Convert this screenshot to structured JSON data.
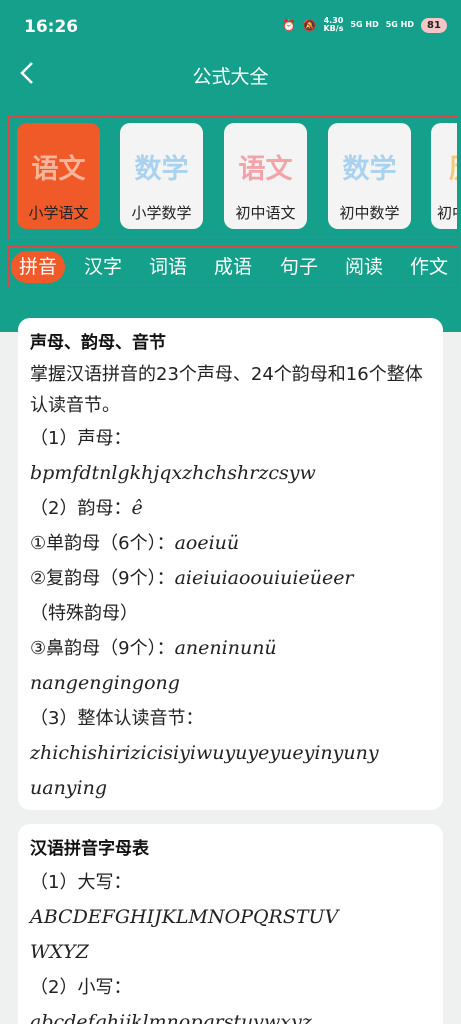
{
  "status": {
    "time": "16:26",
    "speed_top": "4.30",
    "speed_bottom": "KB/s",
    "sig1": "5G HD",
    "sig2": "5G HD",
    "battery": "81"
  },
  "header": {
    "title": "公式大全"
  },
  "categories": [
    {
      "glyph": "语文",
      "label": "小学语文",
      "color": "#f7b49b"
    },
    {
      "glyph": "数学",
      "label": "小学数学",
      "color": "#a9d2ef"
    },
    {
      "glyph": "语文",
      "label": "初中语文",
      "color": "#f4a3a8"
    },
    {
      "glyph": "数学",
      "label": "初中数学",
      "color": "#a9d2ef"
    },
    {
      "glyph": "历",
      "label": "初中",
      "color": "#f3c97a"
    }
  ],
  "tabs": [
    "拼音",
    "汉字",
    "词语",
    "成语",
    "句子",
    "阅读",
    "作文"
  ],
  "card1": {
    "title": "声母、韵母、音节",
    "intro": "掌握汉语拼音的23个声母、24个韵母和16个整体认读音节。",
    "l1": "（1）声母：",
    "l2": "bpmfdtnlgkhjqxzhchshrzcsyw",
    "l3a": "（2）韵母：",
    "l3b": "ê",
    "l4a": "①单韵母（6个）：",
    "l4b": "aoeiuü",
    "l5a": "②复韵母（9个）：",
    "l5b": "aieiuiaoouiuieüeer",
    "l6": "（特殊韵母）",
    "l7a": "③鼻韵母（9个）：",
    "l7b": "aneninunü",
    "l8": "nangengingong",
    "l9": "（3）整体认读音节：",
    "l10": "zhichishirizicisiyiwuyuyeyueyinyuny",
    "l11": "uanying"
  },
  "card2": {
    "title": "汉语拼音字母表",
    "l1": "（1）大写：",
    "l2": "ABCDEFGHIJKLMNOPQRSTUV",
    "l3": "WXYZ",
    "l4": "（2）小写：",
    "l5": "abcdefghijklmnopqrstuvwxyz"
  }
}
